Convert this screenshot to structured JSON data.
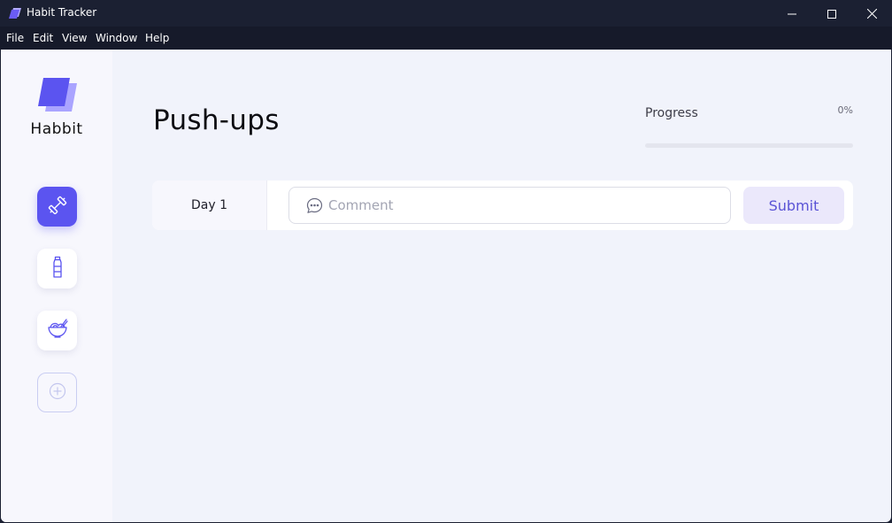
{
  "window": {
    "title": "Habit Tracker",
    "icons": {
      "app": "app-logo-icon",
      "minimize": "minimize-icon",
      "maximize": "maximize-icon",
      "close": "close-icon"
    }
  },
  "menu": [
    {
      "label": "File"
    },
    {
      "label": "Edit"
    },
    {
      "label": "View"
    },
    {
      "label": "Window"
    },
    {
      "label": "Help"
    }
  ],
  "sidebar": {
    "brand": "Habbit",
    "habits": [
      {
        "icon": "dumbbell-icon",
        "active": true
      },
      {
        "icon": "water-bottle-icon",
        "active": false
      },
      {
        "icon": "food-bowl-icon",
        "active": false
      }
    ],
    "add_icon": "add-circle-icon"
  },
  "main": {
    "title": "Push-ups",
    "progress": {
      "label": "Progress",
      "value_text": "0%",
      "value": 0
    },
    "entry": {
      "day_label": "Day 1",
      "comment_placeholder": "Comment",
      "comment_value": "",
      "comment_icon": "chat-bubble-icon",
      "submit_label": "Submit"
    }
  },
  "colors": {
    "accent": "#5b54f0",
    "titlebar": "#1b2032",
    "background": "#f1f3fb",
    "sidebar": "#f7f7fd",
    "submit_bg": "#ebe8fb"
  }
}
